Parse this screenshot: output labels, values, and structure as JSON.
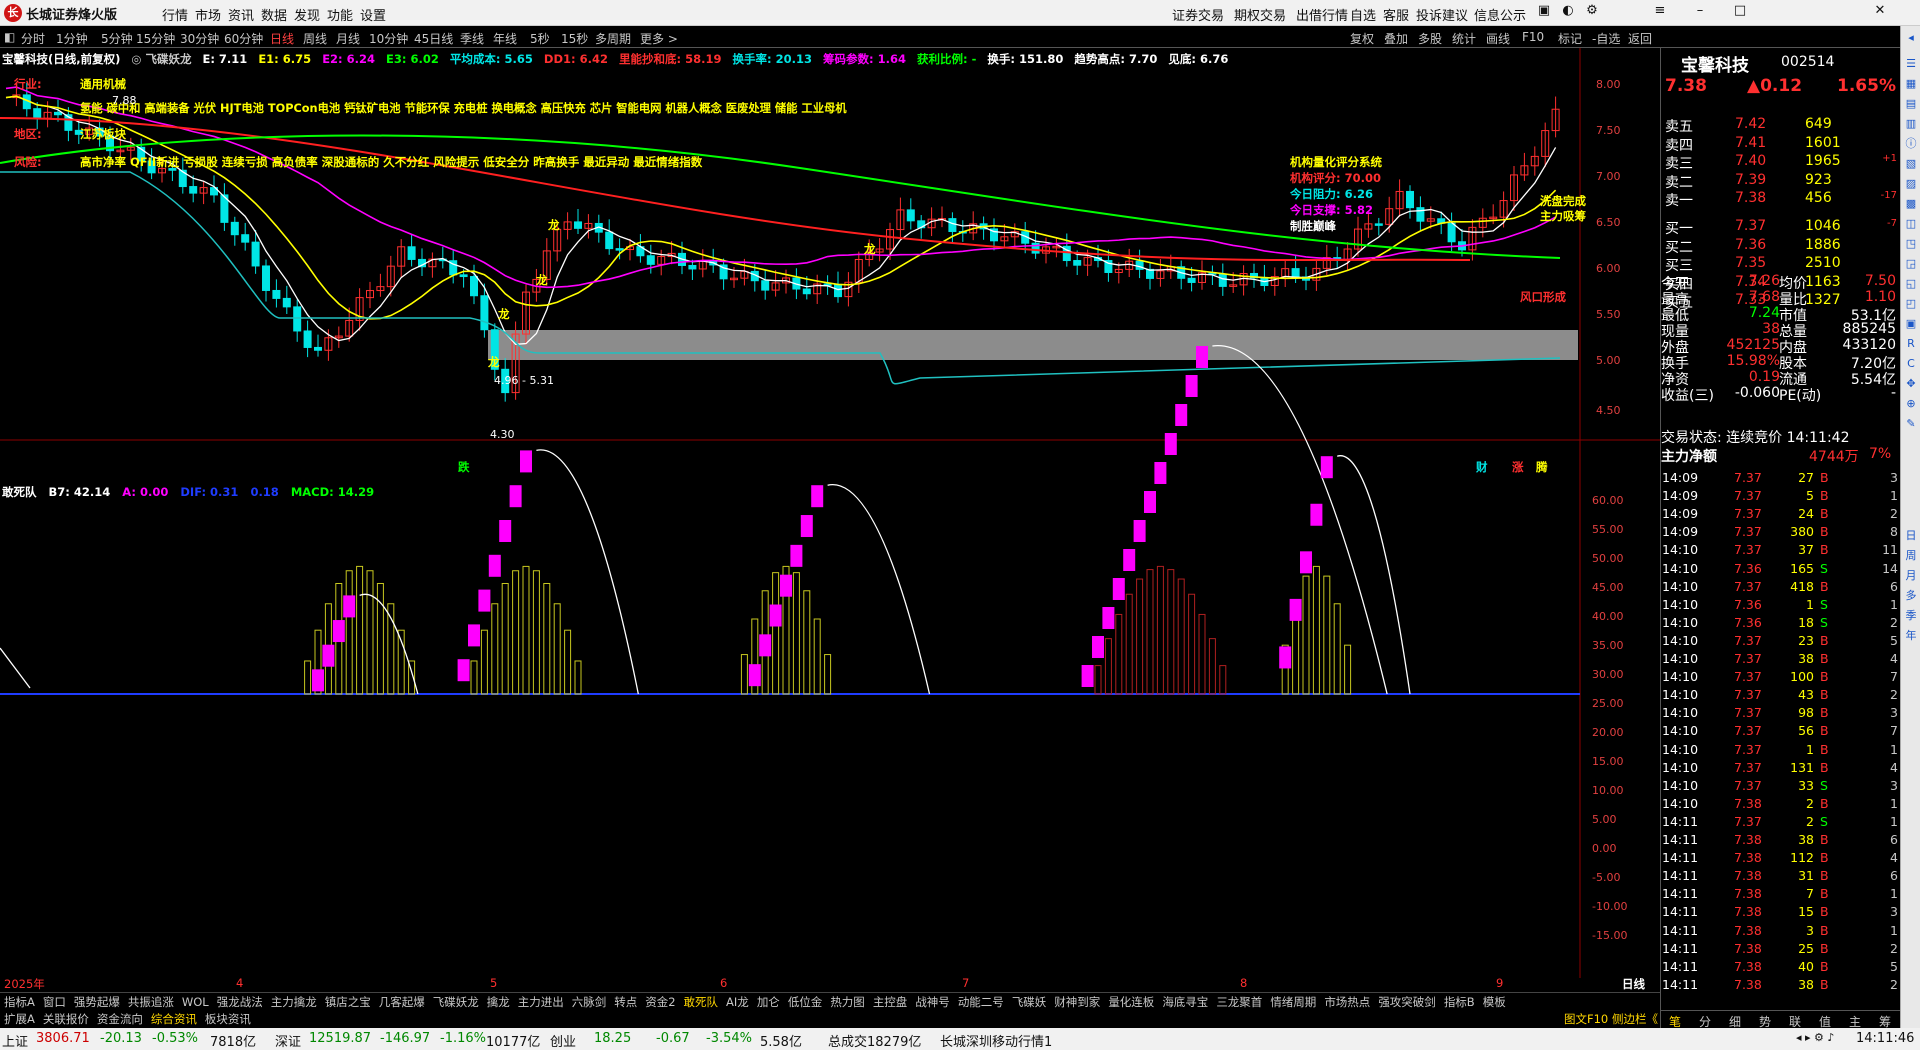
{
  "window": {
    "title": "长城证券烽火版",
    "menus": [
      "行情",
      "市场",
      "资讯",
      "数据",
      "发现",
      "功能",
      "设置"
    ],
    "top_links": [
      "证券交易",
      "期权交易",
      "出借行情",
      "自选",
      "客服",
      "投诉建议",
      "信息公示"
    ]
  },
  "periods": [
    "分时",
    "1分钟",
    "5分钟",
    "15分钟",
    "30分钟",
    "60分钟",
    "日线",
    "周线",
    "月线",
    "10分钟",
    "45日线",
    "季线",
    "年线",
    "5秒",
    "15秒",
    "多周期",
    "更多 >"
  ],
  "active_period": "日线",
  "tools": [
    "复权",
    "叠加",
    "多股",
    "统计",
    "画线",
    "F10",
    "标记",
    "-自选",
    "返回"
  ],
  "stock": {
    "name": "宝馨科技",
    "code": "002514",
    "price": "7.38",
    "change": "▲0.12",
    "pct": "1.65%"
  },
  "infoline": [
    {
      "text": "宝馨科技(日线,前复权)",
      "color": "#ffffff"
    },
    {
      "text": "◎ 飞碟妖龙",
      "color": "#c8c8c8"
    },
    {
      "text": "E: 7.11",
      "color": "#ffffff"
    },
    {
      "text": "E1: 6.75",
      "color": "#ffff00"
    },
    {
      "text": "E2: 6.24",
      "color": "#ff00ff"
    },
    {
      "text": "E3: 6.02",
      "color": "#00ff00"
    },
    {
      "text": "平均成本: 5.65",
      "color": "#00e5e5"
    },
    {
      "text": "DD1: 6.42",
      "color": "#ff3030"
    },
    {
      "text": "里能抄和底: 58.19",
      "color": "#ff3030"
    },
    {
      "text": "换手率: 20.13",
      "color": "#00e5e5"
    },
    {
      "text": "筹码参数: 1.64",
      "color": "#ff00ff"
    },
    {
      "text": "获利比例: -",
      "color": "#00ff00"
    },
    {
      "text": "换手: 151.80",
      "color": "#ffffff"
    },
    {
      "text": "趋势高点: 7.70",
      "color": "#ffffff"
    },
    {
      "text": "见底: 6.76",
      "color": "#ffffff"
    }
  ],
  "tags": {
    "industry_label": "行业:",
    "industry": "通用机械",
    "region_label": "地区:",
    "region": "江苏板块",
    "concepts": "氢能 碳中和 高端装备 光伏 HJT电池 TOPCon电池 钙钛矿电池 节能环保 充电桩 换电概念 高压快充 芯片 智能电网 机器人概念 医废处理 储能 工业母机",
    "risk_label": "风险:",
    "risks": "高市净率 QFII新进 亏损股 连续亏损 高负债率 深股通标的 久不分红 风险提示 低安全分 昨高换手 最近异动 最近情绪指数"
  },
  "annotations": {
    "high_mark": "7.88",
    "range_box": "4.96 - 5.31",
    "low_mark": "4.30",
    "long1": "龙",
    "long2": "龙",
    "long3": "龙",
    "long4": "龙",
    "long5": "龙",
    "fall": "跌",
    "wind": "风口形成",
    "qs_title": "机构量化评分系统",
    "qs_score": "机构评分: 70.00",
    "qs_resist": "今日阻力: 6.26",
    "qs_support": "今日支撑: 5.82",
    "qs_peak": "制胜巅峰",
    "wash": "洗盘完成",
    "main": "主力吸筹",
    "cai": "财",
    "zhang": "涨",
    "teng": "腾"
  },
  "main_yaxis": [
    "8.00",
    "7.50",
    "7.00",
    "6.50",
    "6.00",
    "5.50",
    "5.00",
    "4.50"
  ],
  "sub_yaxis": [
    "60.00",
    "55.00",
    "50.00",
    "45.00",
    "40.00",
    "35.00",
    "30.00",
    "25.00",
    "20.00",
    "15.00",
    "10.00",
    "5.00",
    "0.00",
    "-5.00",
    "-10.00",
    "-15.00"
  ],
  "sub": {
    "name": "敢死队",
    "b7": "B7: 42.14",
    "a": "A: 0.00",
    "dif": "DIF: 0.31",
    "dea": "0.18",
    "macd": "MACD: 14.29"
  },
  "xaxis": [
    "2025年",
    "4",
    "5",
    "6",
    "7",
    "8",
    "9"
  ],
  "xaxis_right": "日线",
  "tabs1": [
    "指标A",
    "窗口",
    "强势起爆",
    "共振追涨",
    "WOL",
    "强龙战法",
    "主力擒龙",
    "镇店之宝",
    "几客起爆",
    "飞碟妖龙",
    "擒龙",
    "主力进出",
    "六脉剑",
    "转点",
    "资金2",
    "敢死队",
    "AI龙",
    "加仑",
    "低位金",
    "热力图",
    "主控盘",
    "战神号",
    "动能二号",
    "飞碟妖",
    "财神到家",
    "量化连板",
    "海底寻宝",
    "三龙聚首",
    "情绪周期",
    "市场热点",
    "强攻突破剑",
    "指标B",
    "模板"
  ],
  "tabs1_active": "敢死队",
  "tabs2": [
    "扩展A",
    "关联报价",
    "资金流向",
    "综合资讯",
    "板块资讯"
  ],
  "tabs2_active": "综合资讯",
  "sells": [
    [
      "卖五",
      "7.42",
      "649",
      ""
    ],
    [
      "卖四",
      "7.41",
      "1601",
      ""
    ],
    [
      "卖三",
      "7.40",
      "1965",
      "+1"
    ],
    [
      "卖二",
      "7.39",
      "923",
      ""
    ],
    [
      "卖一",
      "7.38",
      "456",
      "-17"
    ]
  ],
  "buys": [
    [
      "买一",
      "7.37",
      "1046",
      "-7"
    ],
    [
      "买二",
      "7.36",
      "1886",
      ""
    ],
    [
      "买三",
      "7.35",
      "2510",
      ""
    ],
    [
      "买四",
      "7.34",
      "1163",
      ""
    ],
    [
      "买五",
      "7.33",
      "1327",
      ""
    ]
  ],
  "quote": [
    [
      "今开",
      "7.26",
      "均价",
      "7.50"
    ],
    [
      "最高",
      "7.68",
      "量比",
      "1.10"
    ],
    [
      "最低",
      "7.24",
      "市值",
      "53.1亿"
    ],
    [
      "现量",
      "38",
      "总量",
      "885245"
    ],
    [
      "外盘",
      "452125",
      "内盘",
      "433120"
    ],
    [
      "换手",
      "15.98%",
      "股本",
      "7.20亿"
    ],
    [
      "净资",
      "0.19",
      "流通",
      "5.54亿"
    ],
    [
      "收益(三)",
      "-0.060",
      "PE(动)",
      "-"
    ]
  ],
  "trade_status": "交易状态: 连续竞价 14:11:42",
  "main_net": {
    "label": "主力净额",
    "value": "4744万",
    "pct": "7%"
  },
  "ticks": [
    [
      "14:09",
      "7.37",
      "27",
      "B",
      "3"
    ],
    [
      "14:09",
      "7.37",
      "5",
      "B",
      "1"
    ],
    [
      "14:09",
      "7.37",
      "24",
      "B",
      "2"
    ],
    [
      "14:09",
      "7.37",
      "380",
      "B",
      "8"
    ],
    [
      "14:10",
      "7.37",
      "37",
      "B",
      "11"
    ],
    [
      "14:10",
      "7.36",
      "165",
      "S",
      "14"
    ],
    [
      "14:10",
      "7.37",
      "418",
      "B",
      "6"
    ],
    [
      "14:10",
      "7.36",
      "1",
      "S",
      "1"
    ],
    [
      "14:10",
      "7.36",
      "18",
      "S",
      "2"
    ],
    [
      "14:10",
      "7.37",
      "23",
      "B",
      "5"
    ],
    [
      "14:10",
      "7.37",
      "38",
      "B",
      "4"
    ],
    [
      "14:10",
      "7.37",
      "100",
      "B",
      "7"
    ],
    [
      "14:10",
      "7.37",
      "43",
      "B",
      "2"
    ],
    [
      "14:10",
      "7.37",
      "98",
      "B",
      "3"
    ],
    [
      "14:10",
      "7.37",
      "56",
      "B",
      "7"
    ],
    [
      "14:10",
      "7.37",
      "1",
      "B",
      "1"
    ],
    [
      "14:10",
      "7.37",
      "131",
      "B",
      "4"
    ],
    [
      "14:10",
      "7.37",
      "33",
      "S",
      "3"
    ],
    [
      "14:10",
      "7.38",
      "2",
      "B",
      "1"
    ],
    [
      "14:11",
      "7.37",
      "2",
      "S",
      "1"
    ],
    [
      "14:11",
      "7.38",
      "38",
      "B",
      "6"
    ],
    [
      "14:11",
      "7.38",
      "112",
      "B",
      "4"
    ],
    [
      "14:11",
      "7.38",
      "31",
      "B",
      "6"
    ],
    [
      "14:11",
      "7.38",
      "7",
      "B",
      "1"
    ],
    [
      "14:11",
      "7.38",
      "15",
      "B",
      "3"
    ],
    [
      "14:11",
      "7.38",
      "3",
      "B",
      "1"
    ],
    [
      "14:11",
      "7.38",
      "25",
      "B",
      "2"
    ],
    [
      "14:11",
      "7.38",
      "40",
      "B",
      "5"
    ],
    [
      "14:11",
      "7.38",
      "38",
      "B",
      "2"
    ]
  ],
  "rp_tabs": [
    "笔",
    "分",
    "细",
    "势",
    "联",
    "值",
    "主",
    "筹"
  ],
  "status": {
    "sh_label": "上证",
    "sh": "3806.71",
    "sh_chg": "-20.13",
    "sh_pct": "-0.53%",
    "sh_amt": "7818亿",
    "sz_label": "深证",
    "sz": "12519.87",
    "sz_chg": "-146.97",
    "sz_pct": "-1.16%",
    "sz_amt": "10177亿",
    "cy_label": "创业",
    "cy": "18.25",
    "cy_chg": "-0.67",
    "cy_pct": "-3.54%",
    "cy_amt": "5.58亿",
    "total": "总成交18279亿",
    "server": "长城深圳移动行情1",
    "time": "14:11:46"
  },
  "mini_bar": {
    "f10": "图文F10",
    "side": "侧边栏《"
  },
  "sidebar_labels": [
    "日",
    "周",
    "月",
    "多",
    "季",
    "年"
  ],
  "colors": {
    "up": "#ff3030",
    "down": "#00e5e5",
    "magenta": "#ff00ff",
    "yellow": "#ffff00",
    "green": "#00ff00"
  }
}
